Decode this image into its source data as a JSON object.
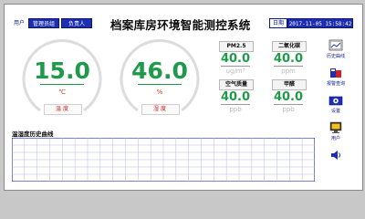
{
  "app": {
    "title": "档案库房环境智能测控系统"
  },
  "user": {
    "label": "用户",
    "role": "管理员组",
    "name": "负责人"
  },
  "datetime": {
    "label": "日期",
    "value": "2017-11-05 15:58:42"
  },
  "gauges": [
    {
      "value": "15.0",
      "unit": "℃",
      "label": "温度"
    },
    {
      "value": "46.0",
      "unit": "%",
      "label": "湿度"
    }
  ],
  "sensors": [
    {
      "label": "PM2.5",
      "value": "40.0",
      "unit": "ug/m³"
    },
    {
      "label": "二氧化碳",
      "value": "40.0",
      "unit": "ppm"
    },
    {
      "label": "空气质量",
      "value": "40.0",
      "unit": "ppb"
    },
    {
      "label": "甲醛",
      "value": "40.0",
      "unit": "ppb"
    }
  ],
  "sidebar": {
    "items": [
      {
        "label": "历史曲线",
        "icon": "chart-icon"
      },
      {
        "label": "报警查询",
        "icon": "alarm-icon"
      },
      {
        "label": "设置",
        "icon": "settings-icon"
      },
      {
        "label": "用户",
        "icon": "monitor-icon"
      },
      {
        "label": "",
        "icon": "speaker-icon"
      }
    ]
  },
  "chart": {
    "title": "温湿度历史曲线"
  },
  "colors": {
    "accent": "#1d2fb0",
    "value": "#1e9a4a",
    "alert": "#d02020"
  }
}
